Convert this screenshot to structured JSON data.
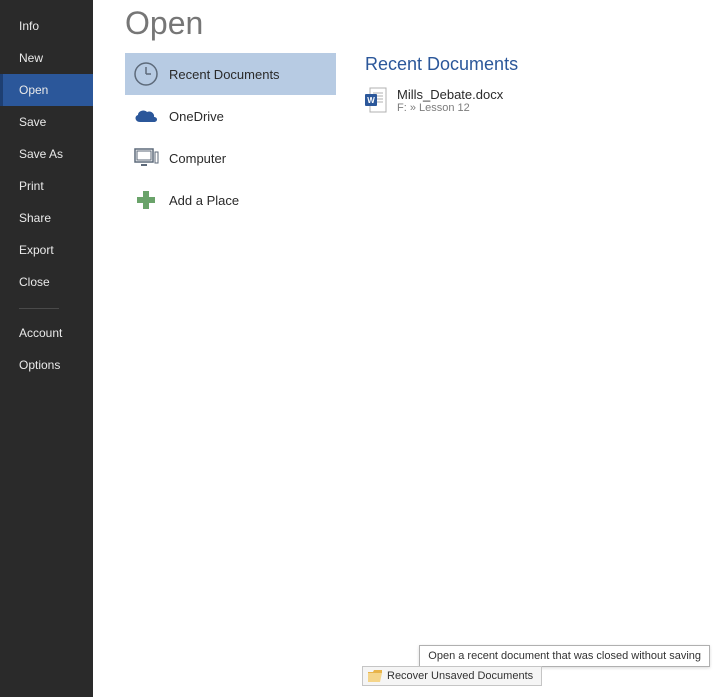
{
  "sidebar": {
    "items": [
      {
        "label": "Info"
      },
      {
        "label": "New"
      },
      {
        "label": "Open"
      },
      {
        "label": "Save"
      },
      {
        "label": "Save As"
      },
      {
        "label": "Print"
      },
      {
        "label": "Share"
      },
      {
        "label": "Export"
      },
      {
        "label": "Close"
      },
      {
        "label": "Account"
      },
      {
        "label": "Options"
      }
    ],
    "selected_index": 2
  },
  "page": {
    "title": "Open"
  },
  "sources": {
    "items": [
      {
        "label": "Recent Documents",
        "icon": "clock"
      },
      {
        "label": "OneDrive",
        "icon": "cloud"
      },
      {
        "label": "Computer",
        "icon": "computer"
      },
      {
        "label": "Add a Place",
        "icon": "plus"
      }
    ],
    "selected_index": 0
  },
  "recent": {
    "title": "Recent Documents",
    "documents": [
      {
        "name": "Mills_Debate.docx",
        "path": "F: » Lesson 12"
      }
    ]
  },
  "recover": {
    "label": "Recover Unsaved Documents",
    "tooltip": "Open a recent document that was closed without saving"
  }
}
